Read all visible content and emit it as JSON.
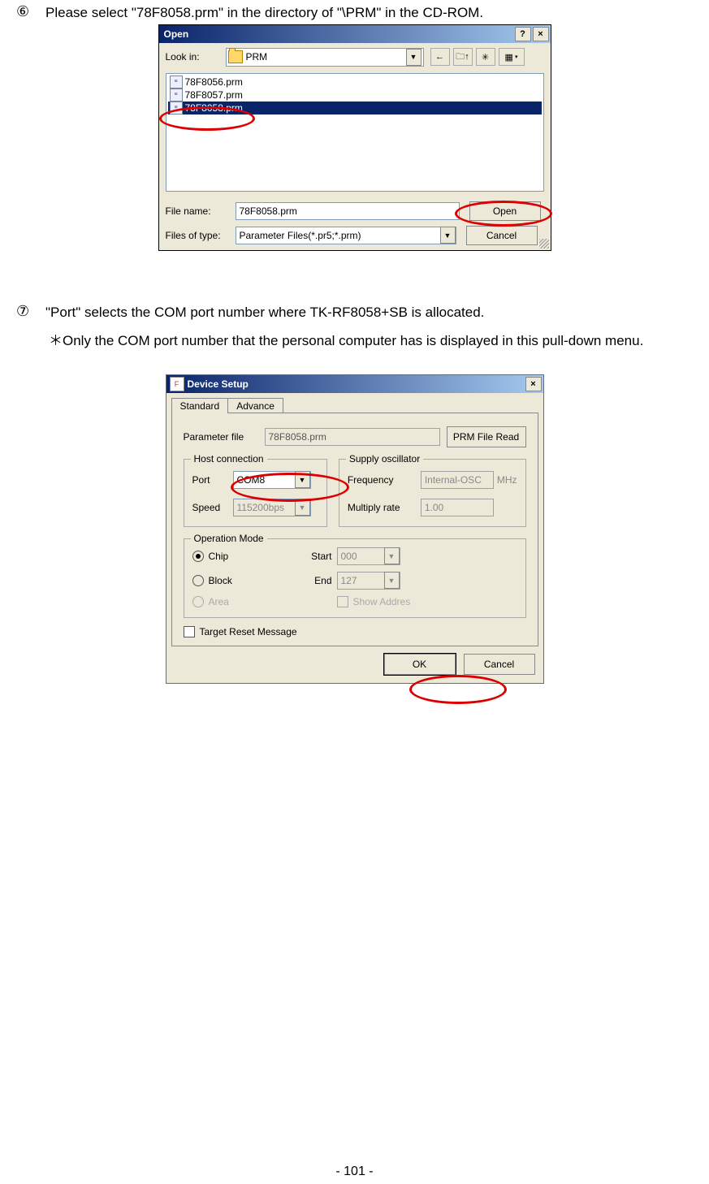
{
  "step6": {
    "num": "⑥",
    "text": "Please select \"78F8058.prm\" in the directory of \"\\PRM\" in the CD-ROM."
  },
  "open": {
    "title": "Open",
    "help_btn": "?",
    "close_btn": "×",
    "look_in_label": "Look in:",
    "look_in_value": "PRM",
    "nav": {
      "back": "←",
      "up": "🗀↑",
      "new": "✳",
      "view": "▦",
      "view_dd": "▾"
    },
    "files": [
      {
        "name": "78F8056.prm",
        "selected": false
      },
      {
        "name": "78F8057.prm",
        "selected": false
      },
      {
        "name": "78F8058.prm",
        "selected": true
      }
    ],
    "filename_label": "File name:",
    "filename_value": "78F8058.prm",
    "filetype_label": "Files of type:",
    "filetype_value": "Parameter Files(*.pr5;*.prm)",
    "open_btn": "Open",
    "cancel_btn": "Cancel"
  },
  "step7": {
    "num": "⑦",
    "text": "\"Port\" selects the COM port number where TK-RF8058+SB is allocated.",
    "note": "＊Only the COM port number that the personal computer has is displayed in this pull-down menu."
  },
  "device": {
    "title": "Device Setup",
    "close_btn": "×",
    "tabs": {
      "standard": "Standard",
      "advance": "Advance"
    },
    "param": {
      "label": "Parameter file",
      "value": "78F8058.prm",
      "btn": "PRM File Read"
    },
    "host": {
      "title": "Host connection",
      "port_label": "Port",
      "port_value": "COM8",
      "speed_label": "Speed",
      "speed_value": "115200bps"
    },
    "osc": {
      "title": "Supply oscillator",
      "freq_label": "Frequency",
      "freq_value": "Internal-OSC",
      "freq_unit": "MHz",
      "mult_label": "Multiply rate",
      "mult_value": "1.00"
    },
    "op": {
      "title": "Operation Mode",
      "chip": "Chip",
      "block": "Block",
      "area": "Area",
      "start_label": "Start",
      "start_value": "000",
      "end_label": "End",
      "end_value": "127",
      "show": "Show Addres"
    },
    "target_reset": "Target Reset Message",
    "ok_btn": "OK",
    "cancel_btn": "Cancel"
  },
  "page_num": "- 101 -"
}
